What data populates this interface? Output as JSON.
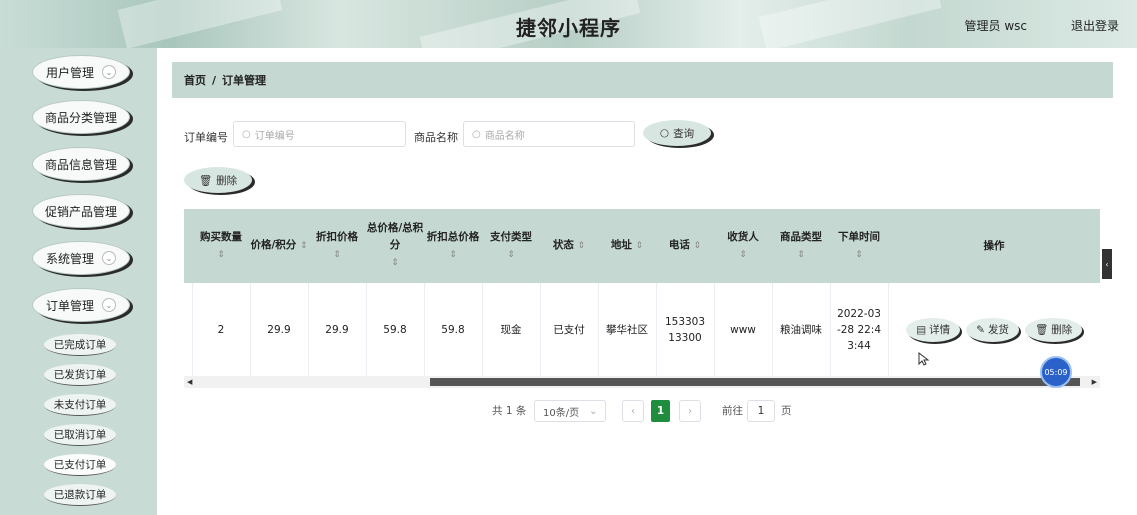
{
  "header": {
    "title": "捷邻小程序",
    "admin": "管理员 wsc",
    "logout": "退出登录"
  },
  "sidebar": {
    "menus": [
      {
        "label": "用户管理",
        "has_chevron": true
      },
      {
        "label": "商品分类管理",
        "has_chevron": false
      },
      {
        "label": "商品信息管理",
        "has_chevron": false
      },
      {
        "label": "促销产品管理",
        "has_chevron": false
      },
      {
        "label": "系统管理",
        "has_chevron": true
      },
      {
        "label": "订单管理",
        "has_chevron": true
      }
    ],
    "submenus": [
      "已完成订单",
      "已发货订单",
      "未支付订单",
      "已取消订单",
      "已支付订单",
      "已退款订单"
    ],
    "active_submenu": "已支付订单"
  },
  "breadcrumb": {
    "home": "首页",
    "separator": "/",
    "current": "订单管理"
  },
  "search": {
    "order_no_label": "订单编号",
    "order_no_placeholder": "订单编号",
    "product_name_label": "商品名称",
    "product_name_placeholder": "商品名称",
    "query_label": "查询",
    "delete_label": "删除"
  },
  "table": {
    "headers": [
      "购买数量",
      "价格/积分",
      "折扣价格",
      "总价格/总积分",
      "折扣总价格",
      "支付类型",
      "状态",
      "地址",
      "电话",
      "收货人",
      "商品类型",
      "下单时间",
      "操作"
    ],
    "rows": [
      {
        "quantity": "2",
        "price": "29.9",
        "discount_price": "29.9",
        "total": "59.8",
        "discount_total": "59.8",
        "pay_type": "现金",
        "status": "已支付",
        "address": "攀华社区",
        "phone": "15330313300",
        "receiver": "www",
        "product_type": "粮油调味",
        "order_time": "2022-03-28 22:43:44"
      }
    ],
    "actions": {
      "detail": "详情",
      "ship": "发货",
      "delete": "删除"
    }
  },
  "pagination": {
    "total": "共 1 条",
    "page_size": "10条/页",
    "current_page": "1",
    "goto_prefix": "前往",
    "goto_value": "1",
    "goto_suffix": "页"
  },
  "overlay": {
    "timer": "05:09"
  },
  "colors": {
    "header_bg": "#b7cfc6",
    "sidebar_bg": "#c8dcd5",
    "table_header_bg": "#c5d9d2",
    "active_page": "#1e8e3e",
    "timer": "#2a62c9"
  }
}
